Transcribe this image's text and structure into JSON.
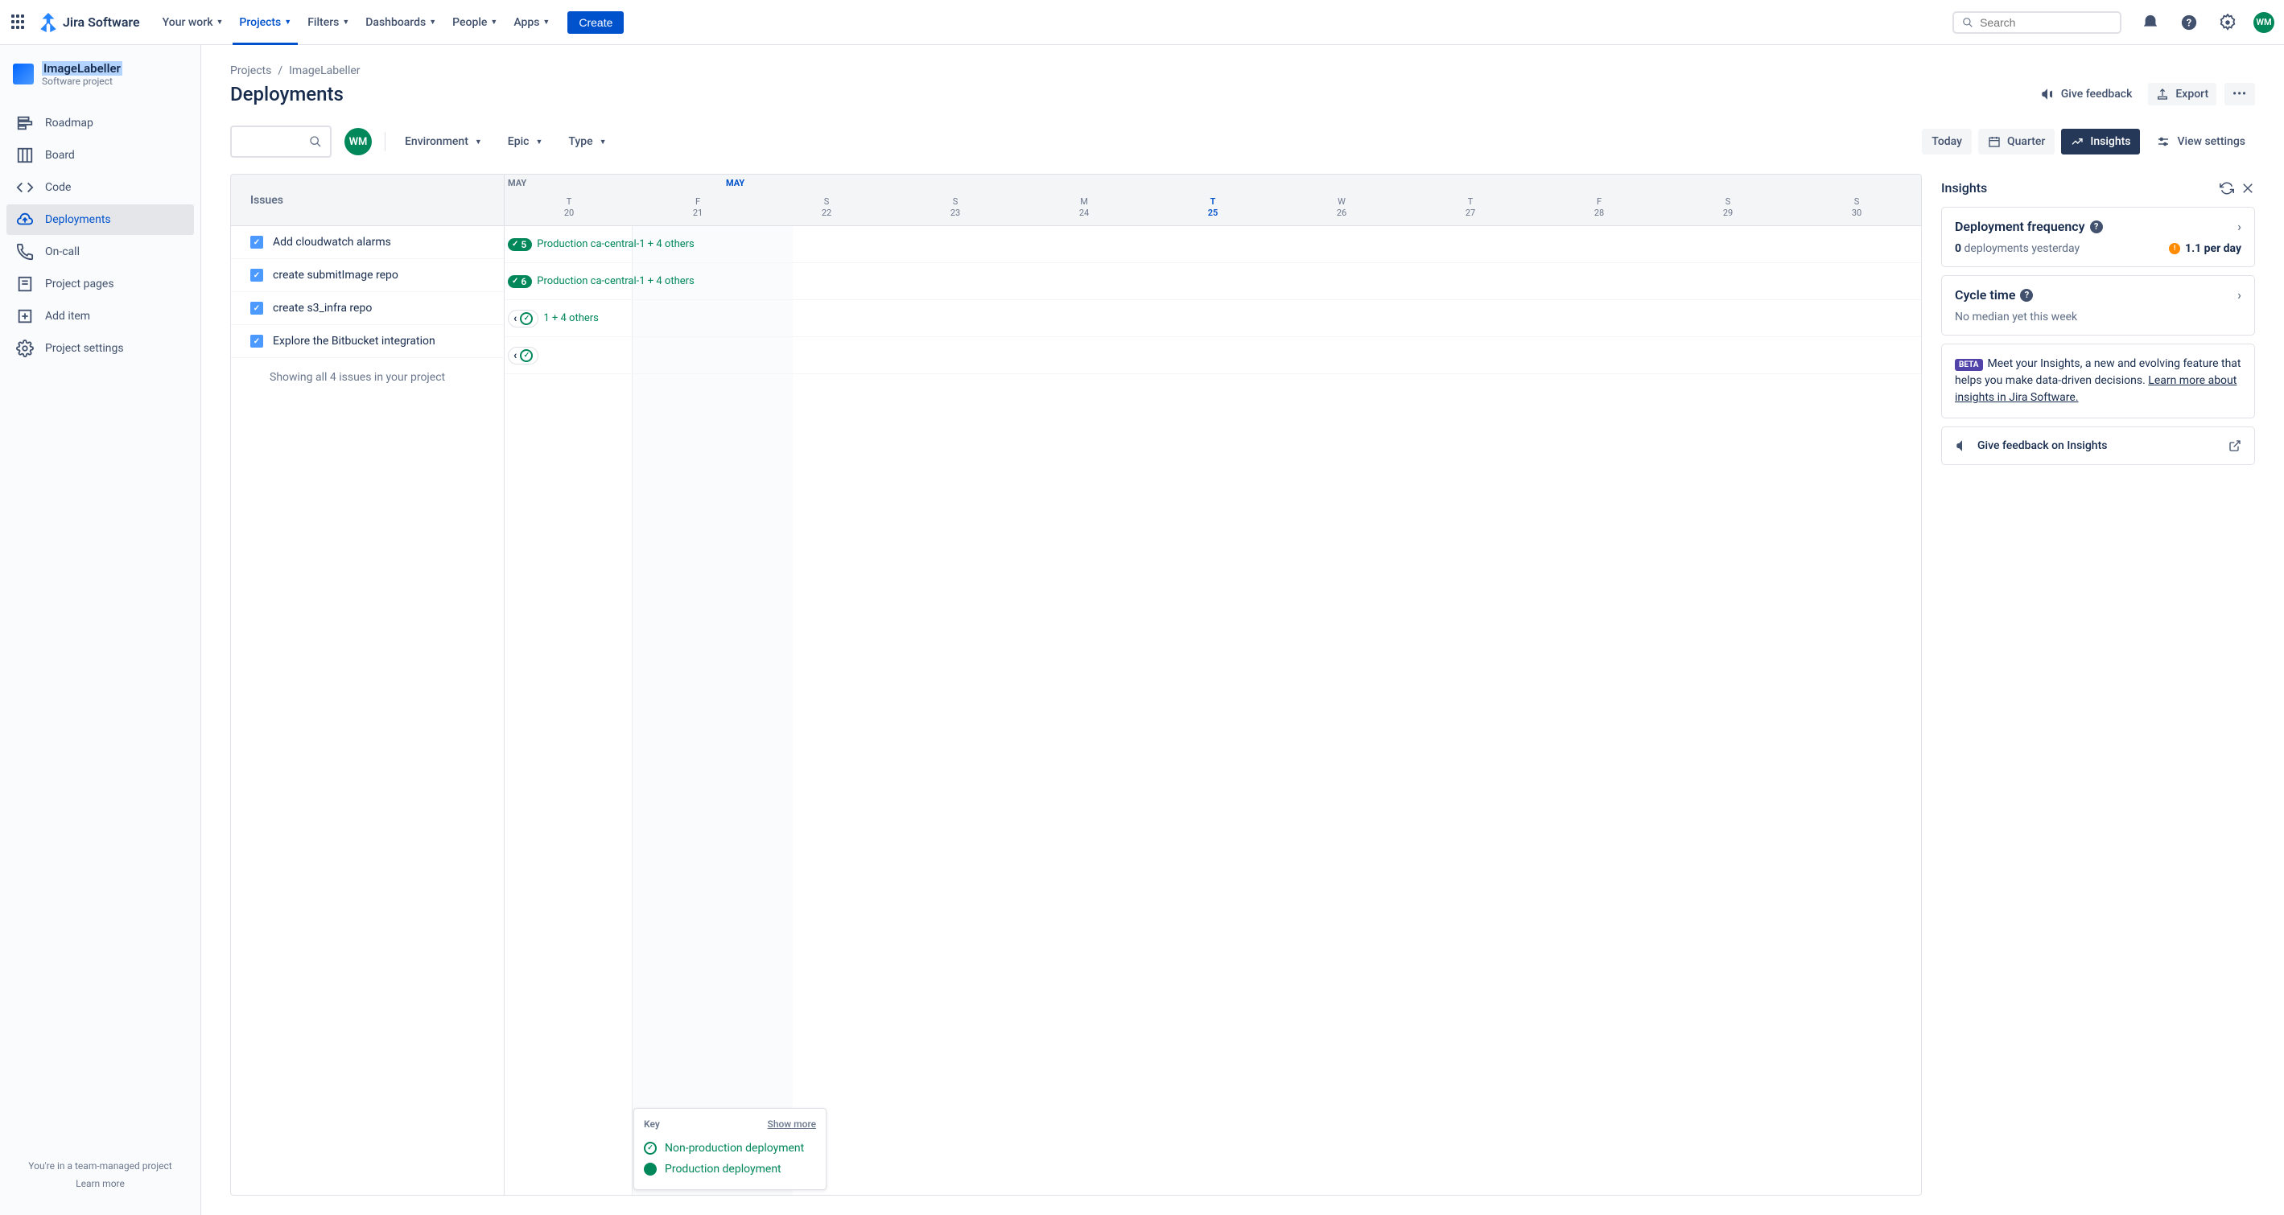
{
  "topnav": {
    "logo": "Jira Software",
    "items": [
      "Your work",
      "Projects",
      "Filters",
      "Dashboards",
      "People",
      "Apps"
    ],
    "active_index": 1,
    "create": "Create",
    "search_placeholder": "Search",
    "avatar": "WM"
  },
  "sidebar": {
    "project_name": "ImageLabeller",
    "project_type": "Software project",
    "items": [
      "Roadmap",
      "Board",
      "Code",
      "Deployments",
      "On-call",
      "Project pages",
      "Add item",
      "Project settings"
    ],
    "active_index": 3,
    "footer_text": "You're in a team-managed project",
    "footer_link": "Learn more"
  },
  "breadcrumb": [
    "Projects",
    "ImageLabeller"
  ],
  "page_title": "Deployments",
  "title_actions": {
    "feedback": "Give feedback",
    "export": "Export"
  },
  "filters": {
    "avatar": "WM",
    "dropdowns": [
      "Environment",
      "Epic",
      "Type"
    ],
    "today": "Today",
    "quarter": "Quarter",
    "insights": "Insights",
    "view_settings": "View settings"
  },
  "timeline": {
    "issues_header": "Issues",
    "month": "MAY",
    "days": [
      {
        "d": "T",
        "n": "20"
      },
      {
        "d": "F",
        "n": "21"
      },
      {
        "d": "S",
        "n": "22"
      },
      {
        "d": "S",
        "n": "23"
      },
      {
        "d": "M",
        "n": "24"
      },
      {
        "d": "T",
        "n": "25"
      },
      {
        "d": "W",
        "n": "26"
      },
      {
        "d": "T",
        "n": "27"
      },
      {
        "d": "F",
        "n": "28"
      },
      {
        "d": "S",
        "n": "29"
      },
      {
        "d": "S",
        "n": "30"
      }
    ],
    "today_index": 5,
    "issues": [
      {
        "summary": "Add cloudwatch alarms",
        "badge": "5",
        "text": "Production ca-central-1 + 4 others"
      },
      {
        "summary": "create submitImage repo",
        "badge": "6",
        "text": "Production ca-central-1 + 4 others"
      },
      {
        "summary": "create s3_infra repo",
        "pill": true,
        "text": "1 + 4 others"
      },
      {
        "summary": "Explore the Bitbucket integration",
        "pill": true,
        "text": ""
      }
    ],
    "showing": "Showing all 4 issues in your project",
    "key": {
      "title": "Key",
      "more": "Show more",
      "nonprod": "Non-production deployment",
      "prod": "Production deployment"
    }
  },
  "insights": {
    "title": "Insights",
    "freq": {
      "title": "Deployment frequency",
      "line1_bold": "0",
      "line1_text": "deployments yesterday",
      "metric": "1.1 per day"
    },
    "cycle": {
      "title": "Cycle time",
      "text": "No median yet this week"
    },
    "beta": {
      "badge": "BETA",
      "text": "Meet your Insights, a new and evolving feature that helps you make data-driven decisions.",
      "link": "Learn more about insights in Jira Software."
    },
    "feedback": "Give feedback on Insights"
  }
}
